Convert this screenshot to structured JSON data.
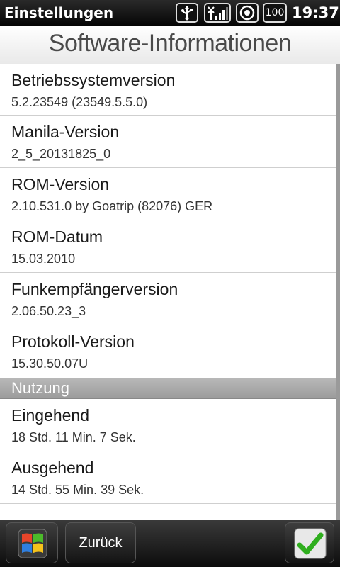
{
  "statusbar": {
    "title": "Einstellungen",
    "battery_text": "100",
    "time": "19:37"
  },
  "header": {
    "title": "Software-Informationen"
  },
  "items_top": [
    {
      "label": "Betriebssystemversion",
      "value": "5.2.23549 (23549.5.5.0)"
    },
    {
      "label": "Manila-Version",
      "value": "2_5_20131825_0"
    },
    {
      "label": "ROM-Version",
      "value": "2.10.531.0 by Goatrip (82076) GER"
    },
    {
      "label": "ROM-Datum",
      "value": "15.03.2010"
    },
    {
      "label": "Funkempfängerversion",
      "value": "2.06.50.23_3"
    },
    {
      "label": "Protokoll-Version",
      "value": "15.30.50.07U"
    }
  ],
  "section": {
    "label": "Nutzung"
  },
  "items_usage": [
    {
      "label": "Eingehend",
      "value": "18 Std. 11 Min. 7 Sek."
    },
    {
      "label": "Ausgehend",
      "value": "14 Std. 55 Min. 39 Sek."
    }
  ],
  "bottombar": {
    "back_label": "Zurück"
  },
  "colors": {
    "section_bg": "#a8a8a8",
    "check_green": "#2fae1e"
  },
  "icons": [
    "usb-icon",
    "signal-icon",
    "data-icon",
    "battery-icon",
    "start-icon",
    "checkmark-icon"
  ]
}
